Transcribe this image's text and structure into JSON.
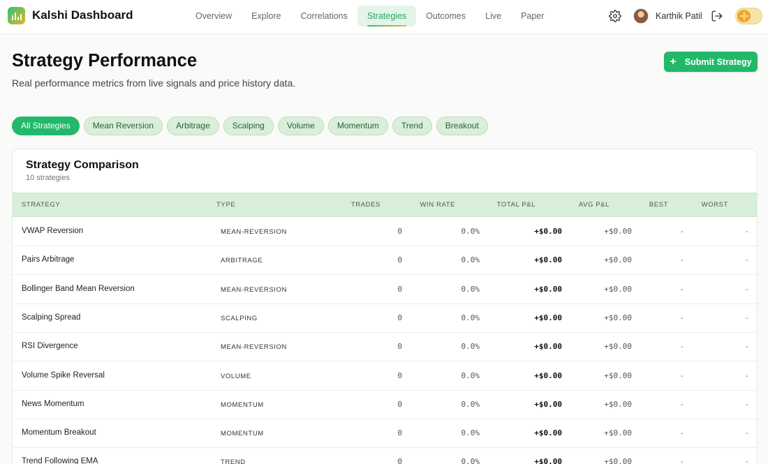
{
  "app": {
    "title": "Kalshi Dashboard"
  },
  "nav": {
    "items": [
      "Overview",
      "Explore",
      "Correlations",
      "Strategies",
      "Outcomes",
      "Live",
      "Paper"
    ],
    "active": "Strategies"
  },
  "user": {
    "name": "Karthik Patil"
  },
  "icons": {
    "settings": "gear-icon",
    "logout": "logout-icon",
    "theme": "sun-icon",
    "add": "plus-icon"
  },
  "colors": {
    "accent": "#22b86a",
    "chip_bg": "#d9efda",
    "table_header_bg": "#d7eed8"
  },
  "header": {
    "title": "Strategy Performance",
    "subtitle": "Real performance metrics from live signals and price history data.",
    "submit_label": "Submit Strategy"
  },
  "filters": {
    "items": [
      "All Strategies",
      "Mean Reversion",
      "Arbitrage",
      "Scalping",
      "Volume",
      "Momentum",
      "Trend",
      "Breakout"
    ],
    "active": "All Strategies"
  },
  "comparison": {
    "title": "Strategy Comparison",
    "count_label": "10 strategies",
    "columns": [
      "STRATEGY",
      "TYPE",
      "TRADES",
      "WIN RATE",
      "TOTAL P&L",
      "AVG P&L",
      "BEST",
      "WORST"
    ],
    "rows": [
      {
        "name": "VWAP Reversion",
        "type": "MEAN-REVERSION",
        "trades": "0",
        "win_rate": "0.0%",
        "total_pnl": "+$0.00",
        "avg_pnl": "+$0.00",
        "best": "-",
        "worst": "-"
      },
      {
        "name": "Pairs Arbitrage",
        "type": "ARBITRAGE",
        "trades": "0",
        "win_rate": "0.0%",
        "total_pnl": "+$0.00",
        "avg_pnl": "+$0.00",
        "best": "-",
        "worst": "-"
      },
      {
        "name": "Bollinger Band Mean Reversion",
        "type": "MEAN-REVERSION",
        "trades": "0",
        "win_rate": "0.0%",
        "total_pnl": "+$0.00",
        "avg_pnl": "+$0.00",
        "best": "-",
        "worst": "-"
      },
      {
        "name": "Scalping Spread",
        "type": "SCALPING",
        "trades": "0",
        "win_rate": "0.0%",
        "total_pnl": "+$0.00",
        "avg_pnl": "+$0.00",
        "best": "-",
        "worst": "-"
      },
      {
        "name": "RSI Divergence",
        "type": "MEAN-REVERSION",
        "trades": "0",
        "win_rate": "0.0%",
        "total_pnl": "+$0.00",
        "avg_pnl": "+$0.00",
        "best": "-",
        "worst": "-"
      },
      {
        "name": "Volume Spike Reversal",
        "type": "VOLUME",
        "trades": "0",
        "win_rate": "0.0%",
        "total_pnl": "+$0.00",
        "avg_pnl": "+$0.00",
        "best": "-",
        "worst": "-"
      },
      {
        "name": "News Momentum",
        "type": "MOMENTUM",
        "trades": "0",
        "win_rate": "0.0%",
        "total_pnl": "+$0.00",
        "avg_pnl": "+$0.00",
        "best": "-",
        "worst": "-"
      },
      {
        "name": "Momentum Breakout",
        "type": "MOMENTUM",
        "trades": "0",
        "win_rate": "0.0%",
        "total_pnl": "+$0.00",
        "avg_pnl": "+$0.00",
        "best": "-",
        "worst": "-"
      },
      {
        "name": "Trend Following EMA",
        "type": "TREND",
        "trades": "0",
        "win_rate": "0.0%",
        "total_pnl": "+$0.00",
        "avg_pnl": "+$0.00",
        "best": "-",
        "worst": "-"
      }
    ]
  }
}
